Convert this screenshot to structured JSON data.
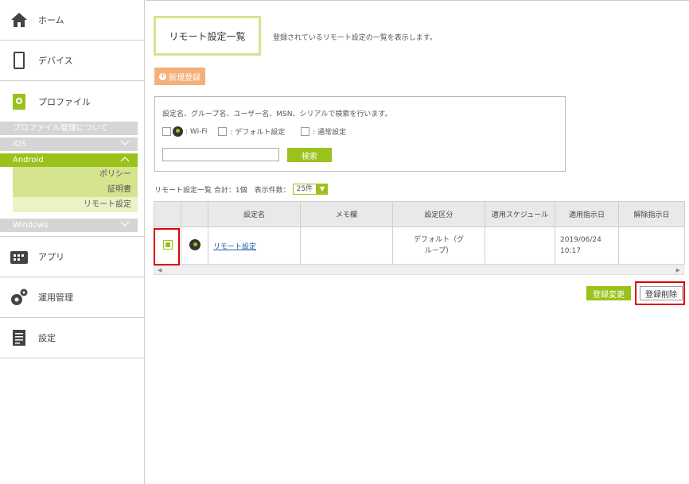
{
  "sidebar": {
    "home": "ホーム",
    "device": "デバイス",
    "profile": "プロファイル",
    "profile_about": "プロファイル管理について",
    "ios": "iOS",
    "android": "Android",
    "android_items": [
      "ポリシー",
      "証明書",
      "リモート設定"
    ],
    "windows": "Windows",
    "app": "アプリ",
    "ops": "運用管理",
    "settings": "設定"
  },
  "main": {
    "title": "リモート設定一覧",
    "description": "登録されているリモート設定の一覧を表示します。",
    "new_button": "新規登録",
    "search": {
      "description": "設定名、グループ名、ユーザー名、MSN、シリアルで検索を行います。",
      "wifi_label": ": Wi-Fi",
      "default_label": ": デフォルト設定",
      "normal_label": ": 通常設定",
      "input_value": "",
      "button": "検索"
    },
    "list_info": "リモート設定一覧 合計：1個　表示件数：",
    "per_page": "25件",
    "table": {
      "headers": [
        "",
        "",
        "設定名",
        "メモ欄",
        "設定区分",
        "適用スケジュール",
        "適用指示日",
        "解除指示日"
      ],
      "row": {
        "name": "リモート設定",
        "memo": "",
        "category": "デフォルト（グループ）",
        "schedule": "",
        "apply_date": "2019/06/24 10:17",
        "release_date": ""
      }
    },
    "edit_button": "登録変更",
    "delete_button": "登録削除"
  },
  "colors": {
    "accent_green": "#9bc21b",
    "light_green": "#d5e58f",
    "orange": "#f5b07a",
    "highlight_red": "#e00000"
  }
}
